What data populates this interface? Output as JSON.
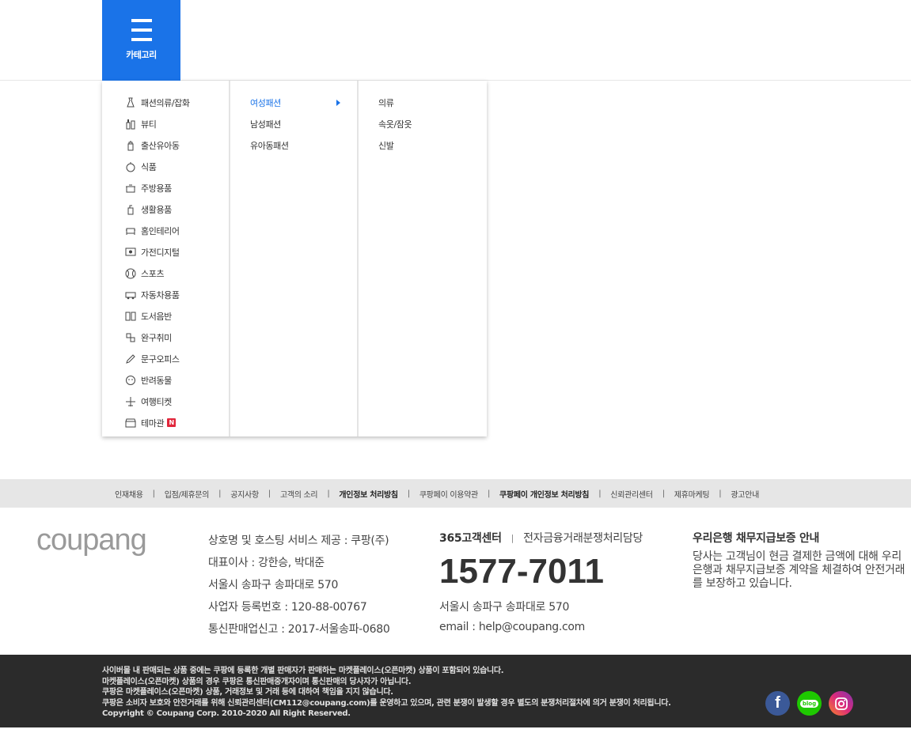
{
  "header": {
    "category_label": "카테고리"
  },
  "menu": {
    "categories": [
      {
        "label": "패션의류/잡화",
        "icon": "dress-icon"
      },
      {
        "label": "뷰티",
        "icon": "cosmetics-icon"
      },
      {
        "label": "출산유아동",
        "icon": "baby-bottle-icon"
      },
      {
        "label": "식품",
        "icon": "apple-icon"
      },
      {
        "label": "주방용품",
        "icon": "pot-icon"
      },
      {
        "label": "생활용품",
        "icon": "detergent-icon"
      },
      {
        "label": "홈인테리어",
        "icon": "sofa-icon"
      },
      {
        "label": "가전디지털",
        "icon": "monitor-icon"
      },
      {
        "label": "스포츠",
        "icon": "ball-icon"
      },
      {
        "label": "자동차용품",
        "icon": "car-icon"
      },
      {
        "label": "도서음반",
        "icon": "book-icon"
      },
      {
        "label": "완구취미",
        "icon": "toy-icon"
      },
      {
        "label": "문구오피스",
        "icon": "pencil-icon"
      },
      {
        "label": "반려동물",
        "icon": "pet-icon"
      },
      {
        "label": "여행티켓",
        "icon": "airplane-icon"
      },
      {
        "label": "테마관",
        "icon": "store-icon",
        "badge": "N"
      }
    ],
    "subcategories": [
      {
        "label": "여성패션",
        "active": true
      },
      {
        "label": "남성패션"
      },
      {
        "label": "유아동패션"
      }
    ],
    "third": [
      {
        "label": "의류"
      },
      {
        "label": "속옷/잠옷"
      },
      {
        "label": "신발"
      }
    ]
  },
  "footer_links": [
    {
      "label": "인재채용"
    },
    {
      "label": "입점/제휴문의"
    },
    {
      "label": "공지사항"
    },
    {
      "label": "고객의 소리"
    },
    {
      "label": "개인정보 처리방침",
      "bold": true
    },
    {
      "label": "쿠팡페이 이용약관"
    },
    {
      "label": "쿠팡페이 개인정보 처리방침",
      "bold": true
    },
    {
      "label": "신뢰관리센터"
    },
    {
      "label": "제휴마케팅"
    },
    {
      "label": "광고안내"
    }
  ],
  "footer": {
    "logo": "coupang",
    "company": {
      "line1": "상호명 및 호스팅 서비스 제공 : 쿠팡(주)",
      "line2": "대표이사 : 강한승, 박대준",
      "line3": "서울시 송파구 송파대로 570",
      "line4": "사업자 등록번호 : 120-88-00767",
      "line5": "통신판매업신고 : 2017-서울송파-0680"
    },
    "cs": {
      "title": "365고객센터",
      "sub": "전자금융거래분쟁처리담당",
      "phone": "1577-7011",
      "address": "서울시 송파구 송파대로 570",
      "email": "email : help@coupang.com"
    },
    "bank": {
      "title": "우리은행 채무지급보증 안내",
      "desc": "당사는 고객님이 현금 결제한 금액에 대해 우리은행과 채무지급보증 계약을 체결하여 안전거래를 보장하고 있습니다."
    },
    "notice": {
      "line1": "사이버몰 내 판매되는 상품 중에는 쿠팡에 등록한 개별 판매자가 판매하는 마켓플레이스(오픈마켓) 상품이 포함되어 있습니다.",
      "line2": "마켓플레이스(오픈마켓) 상품의 경우 쿠팡은 통신판매중개자이며 통신판매의 당사자가 아닙니다.",
      "line3": "쿠팡은 마켓플레이스(오픈마켓) 상품, 거래정보 및 거래 등에 대하여 책임을 지지 않습니다.",
      "line4": "쿠팡은 소비자 보호와 안전거래를 위해 신뢰관리센터(CM112@coupang.com)를 운영하고 있으며, 관련 분쟁이 발생할 경우 별도의 분쟁처리절차에 의거 분쟁이 처리됩니다.",
      "copyright": "Copyright © Coupang Corp. 2010-2020 All Right Reserved."
    },
    "social": {
      "facebook": "f",
      "blog": "blog"
    }
  }
}
